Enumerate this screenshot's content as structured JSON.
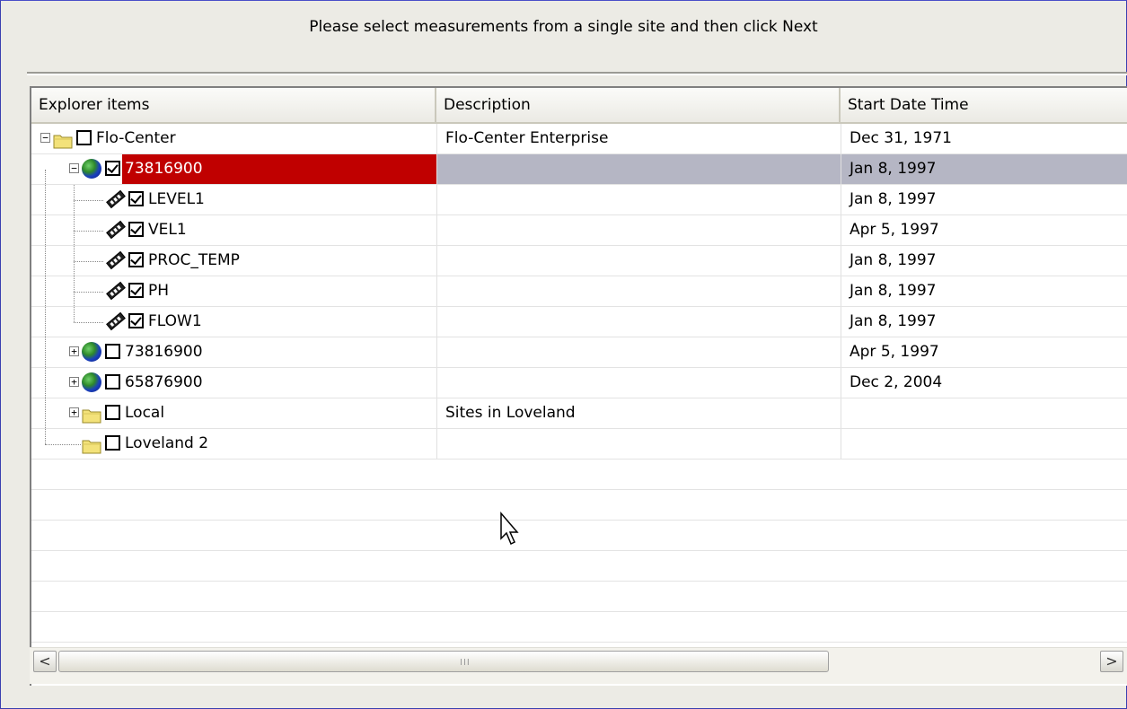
{
  "instruction": "Please select measurements from a single site and then click Next",
  "columns": [
    "Explorer items",
    "Description",
    "Start Date Time"
  ],
  "rows": [
    {
      "label": "Flo-Center",
      "icon": "folder-icon",
      "level": 0,
      "expander": "−",
      "checked": false,
      "description": "Flo-Center Enterprise",
      "start": "Dec 31, 1971",
      "selected": false
    },
    {
      "label": "73816900",
      "icon": "globe-icon",
      "level": 1,
      "expander": "−",
      "checked": true,
      "description": "",
      "start": "Jan 8, 1997",
      "selected": true
    },
    {
      "label": "LEVEL1",
      "icon": "meter-icon",
      "level": 2,
      "expander": "",
      "checked": true,
      "description": "",
      "start": "Jan 8, 1997",
      "selected": false
    },
    {
      "label": "VEL1",
      "icon": "meter-icon",
      "level": 2,
      "expander": "",
      "checked": true,
      "description": "",
      "start": "Apr 5, 1997",
      "selected": false
    },
    {
      "label": "PROC_TEMP",
      "icon": "meter-icon",
      "level": 2,
      "expander": "",
      "checked": true,
      "description": "",
      "start": "Jan 8, 1997",
      "selected": false
    },
    {
      "label": "PH",
      "icon": "meter-icon",
      "level": 2,
      "expander": "",
      "checked": true,
      "description": "",
      "start": "Jan 8, 1997",
      "selected": false
    },
    {
      "label": "FLOW1",
      "icon": "meter-icon",
      "level": 2,
      "expander": "",
      "checked": true,
      "description": "",
      "start": "Jan 8, 1997",
      "selected": false
    },
    {
      "label": "73816900",
      "icon": "globe-icon",
      "level": 1,
      "expander": "+",
      "checked": false,
      "description": "",
      "start": "Apr 5, 1997",
      "selected": false
    },
    {
      "label": "65876900",
      "icon": "globe-icon",
      "level": 1,
      "expander": "+",
      "checked": false,
      "description": "",
      "start": "Dec 2, 2004",
      "selected": false
    },
    {
      "label": "Local",
      "icon": "folder-icon",
      "level": 1,
      "expander": "+",
      "checked": false,
      "description": "Sites in Loveland",
      "start": "",
      "selected": false
    },
    {
      "label": "Loveland 2",
      "icon": "folder-icon",
      "level": 1,
      "expander": "",
      "checked": false,
      "description": "",
      "start": "",
      "selected": false
    }
  ],
  "empty_rows": 6,
  "scrollbar": {
    "left_arrow": "<",
    "right_arrow": ">",
    "grip": "III"
  },
  "colors": {
    "selection": "#b5b6c4",
    "highlight": "#c00000"
  }
}
